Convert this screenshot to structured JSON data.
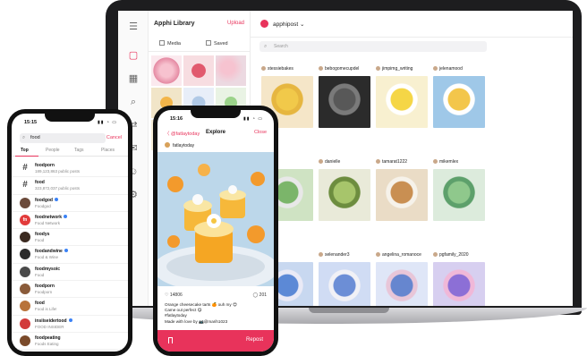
{
  "laptop": {
    "library": {
      "title": "Apphi Library",
      "upload": "Upload",
      "tabs": [
        "Media",
        "Saved"
      ]
    },
    "account": {
      "name": "apphipost ⌄"
    },
    "search": {
      "placeholder": "Search"
    },
    "posts": [
      {
        "user": "stessiebakes",
        "likes": "",
        "comments": "",
        "action": "",
        "repost": "",
        "img": [
          "#f5e6c8",
          "#f1c94a",
          "#e6b640"
        ]
      },
      {
        "user": "bebogomecupdel",
        "likes": "",
        "comments": "",
        "action": "",
        "repost": "",
        "img": [
          "#2b2b2b",
          "#585858",
          "#7a7a7a"
        ]
      },
      {
        "user": "jimpimg_writing",
        "likes": "",
        "comments": "",
        "action": "",
        "repost": "",
        "img": [
          "#f8f0d0",
          "#f5d646",
          "#ffffff"
        ]
      },
      {
        "user": "jelenamood",
        "likes": "",
        "comments": "",
        "action": "",
        "repost": "",
        "img": [
          "#9fc8e8",
          "#f3c64b",
          "#ffffff"
        ]
      },
      {
        "user": "",
        "likes": "",
        "comments": "",
        "action": "",
        "repost": "",
        "img": [
          "#cfe3c3",
          "#7bb56a",
          "#e8e8e8"
        ]
      },
      {
        "user": "danielle",
        "likes": "",
        "comments": "",
        "action": "",
        "repost": "",
        "img": [
          "#e9ead9",
          "#a7c56b",
          "#6d8d3f"
        ]
      },
      {
        "user": "tamarat1222",
        "likes": "",
        "comments": "",
        "action": "",
        "repost": "",
        "img": [
          "#eadcc6",
          "#c98f52",
          "#f6f2ea"
        ]
      },
      {
        "user": "mikemlex",
        "likes": "",
        "comments": "",
        "action": "",
        "repost": "",
        "img": [
          "#dcebdc",
          "#8fc88c",
          "#5da06b"
        ]
      },
      {
        "user": "",
        "likes": "",
        "comments": "",
        "action": "",
        "repost": "",
        "img": [
          "#c8d8f0",
          "#5c89d6",
          "#eaeaf6"
        ]
      },
      {
        "user": "selenander3",
        "likes": "",
        "comments": "",
        "action": "",
        "repost": "",
        "img": [
          "#d0dcf4",
          "#6c8ed6",
          "#f1f1f6"
        ]
      },
      {
        "user": "angelina_romanoce",
        "likes": "",
        "comments": "",
        "action": "",
        "repost": "",
        "img": [
          "#dfe6f7",
          "#6686cf",
          "#e8c6d8"
        ]
      },
      {
        "user": "pgfamily_2020",
        "likes": "",
        "comments": "",
        "action": "",
        "repost": "",
        "img": [
          "#d7cff0",
          "#8c6fd6",
          "#f0b8d8"
        ]
      }
    ]
  },
  "phone1": {
    "time": "15:15",
    "search_value": "food",
    "cancel": "Cancel",
    "tabs": [
      "Top",
      "People",
      "Tags",
      "Places"
    ],
    "results": [
      {
        "name": "foodporn",
        "sub": "189,123,863 public posts",
        "hash": true,
        "avatar": "#",
        "verified": false,
        "color": "#ffffff"
      },
      {
        "name": "food",
        "sub": "323,872,037 public posts",
        "hash": true,
        "avatar": "#",
        "verified": false,
        "color": "#ffffff"
      },
      {
        "name": "foodgod",
        "sub": "Foodgod",
        "hash": false,
        "avatar": "",
        "verified": true,
        "color": "#6b4a3a"
      },
      {
        "name": "foodnetwork",
        "sub": "Food Network",
        "hash": false,
        "avatar": "fn",
        "verified": true,
        "color": "#e23b3b"
      },
      {
        "name": "foodys",
        "sub": "Food",
        "hash": false,
        "avatar": "",
        "verified": false,
        "color": "#3b2a20"
      },
      {
        "name": "foodandwine",
        "sub": "Food & Wine",
        "hash": false,
        "avatar": "",
        "verified": true,
        "color": "#2b2b2b"
      },
      {
        "name": "foodmysoic",
        "sub": "Food",
        "hash": false,
        "avatar": "",
        "verified": false,
        "color": "#4a4a4a"
      },
      {
        "name": "foodporn",
        "sub": "Foodporn",
        "hash": false,
        "avatar": "",
        "verified": false,
        "color": "#8a5b3a"
      },
      {
        "name": "food",
        "sub": "Food is Life!",
        "hash": false,
        "avatar": "",
        "verified": false,
        "color": "#b8733a"
      },
      {
        "name": "insiiseidertood",
        "sub": "FOOD INSIDER",
        "hash": false,
        "avatar": "",
        "verified": true,
        "color": "#d23a3a"
      },
      {
        "name": "foodpeating",
        "sub": "Foods Eating",
        "hash": false,
        "avatar": "",
        "verified": false,
        "color": "#7a4a2a"
      }
    ]
  },
  "phone2": {
    "time": "15:16",
    "back": "〈 @fatlaytoday",
    "title": "Explore",
    "close": "Close",
    "user": "fatlaytoday",
    "likes": "♡ 14806",
    "comments": "◯ 201",
    "caption": [
      "Orange cheesecake tarts 🍊 ouh my 😍",
      "Came out perfect 😋",
      "#fatlaytoday",
      "Made with love by 📷@marih1023"
    ],
    "repost": "Repost"
  }
}
